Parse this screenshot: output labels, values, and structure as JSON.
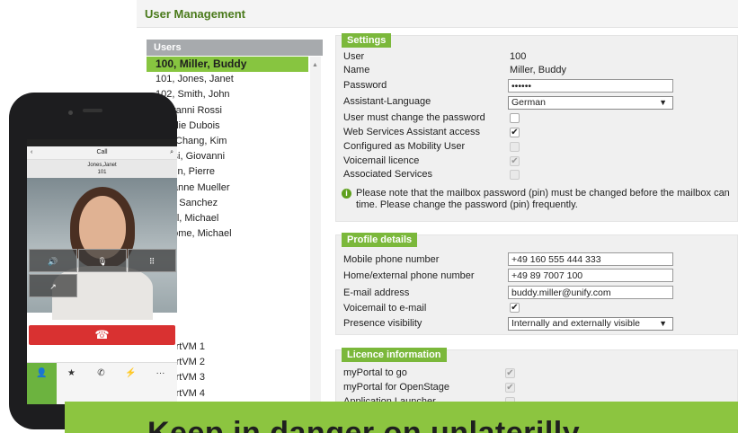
{
  "page_title": "User Management",
  "users": {
    "header": "Users",
    "items": [
      "100, Miller, Buddy",
      "101, Jones, Janet",
      "102, Smith, John",
      "Giovanni Rossi",
      "Natalie Dubois",
      "Kim Chang, Kim",
      "Rossi, Giovanni",
      "Martin, Pierre",
      "Susanne Mueller",
      "Jose Sanchez",
      "Mobil, Michael",
      "@Home, Michael"
    ],
    "items_lower": [
      "SmartVM 1",
      "SmartVM 2",
      "SmartVM 3",
      "SmartVM 4"
    ]
  },
  "settings": {
    "tag": "Settings",
    "user_label": "User",
    "user_value": "100",
    "name_label": "Name",
    "name_value": "Miller, Buddy",
    "password_label": "Password",
    "password_value": "••••••",
    "language_label": "Assistant-Language",
    "language_value": "German",
    "must_change_label": "User must change the password",
    "must_change": false,
    "web_services_label": "Web Services Assistant access",
    "web_services": true,
    "mobility_label": "Configured as Mobility User",
    "mobility": false,
    "voicemail_label": "Voicemail licence",
    "voicemail": true,
    "associated_label": "Associated Services",
    "associated": false,
    "note": "Please note that the mailbox password (pin) must be changed before the mailbox can",
    "note2": "time. Please change the password (pin) frequently."
  },
  "profile": {
    "tag": "Profile details",
    "mobile_label": "Mobile phone number",
    "mobile_value": "+49 160 555 444 333",
    "home_label": "Home/external phone number",
    "home_value": "+49 89 7007 100",
    "email_label": "E-mail address",
    "email_value": "buddy.miller@unify.com",
    "vm_email_label": "Voicemail to e-mail",
    "vm_email": true,
    "presence_label": "Presence visibility",
    "presence_value": "Internally and externally visible"
  },
  "licence": {
    "tag": "Licence information",
    "portal_label": "myPortal to go",
    "portal": true,
    "openstage_label": "myPortal for OpenStage",
    "openstage": true,
    "launcher_label": "Application Launcher",
    "launcher": false
  },
  "phone": {
    "nav_title": "Call",
    "callee_name": "Jones,Janet",
    "callee_number": "101"
  },
  "banner": {
    "text": "Keep in danger on unlaterilly"
  },
  "colors": {
    "accent_green": "#7bb83b",
    "title_green": "#4a7a1b",
    "hangup_red": "#d93131"
  }
}
